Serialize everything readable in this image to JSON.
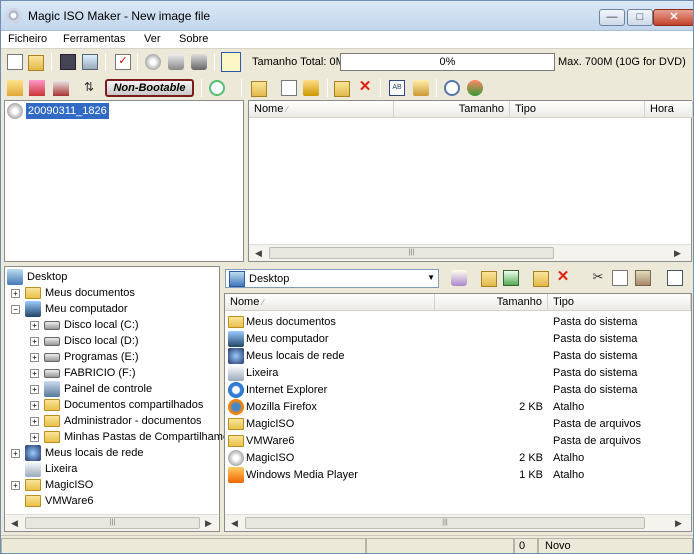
{
  "window": {
    "title": "Magic ISO Maker - New image file"
  },
  "menu": [
    "Ficheiro",
    "Ferramentas",
    "Ver",
    "Sobre"
  ],
  "toolbar": {
    "total_label": "Tamanho Total: 0M",
    "progress_text": "0%",
    "progress_value": 0,
    "max_label": "Max. 700M (10G for DVD)",
    "boot_button": "Non-Bootable"
  },
  "image_tree": {
    "root": "20090311_1826"
  },
  "image_list": {
    "columns": [
      "Nome",
      "Tamanho",
      "Tipo",
      "Hora"
    ]
  },
  "local_tree": {
    "items": [
      {
        "label": "Desktop",
        "level": 0,
        "icon": "desktop-icon"
      },
      {
        "label": "Meus documentos",
        "level": 1,
        "icon": "folder-icon"
      },
      {
        "label": "Meu computador",
        "level": 1,
        "icon": "computer-icon"
      },
      {
        "label": "Disco local (C:)",
        "level": 2,
        "icon": "drive-icon"
      },
      {
        "label": "Disco local (D:)",
        "level": 2,
        "icon": "drive-icon"
      },
      {
        "label": "Programas (E:)",
        "level": 2,
        "icon": "drive-icon"
      },
      {
        "label": "FABRICIO (F:)",
        "level": 2,
        "icon": "drive-icon"
      },
      {
        "label": "Painel de controle",
        "level": 2,
        "icon": "control-panel-icon"
      },
      {
        "label": "Documentos compartilhados",
        "level": 2,
        "icon": "folder-icon"
      },
      {
        "label": "Administrador - documentos",
        "level": 2,
        "icon": "folder-icon"
      },
      {
        "label": "Minhas Pastas de Compartilhamento",
        "level": 2,
        "icon": "share-folder-icon"
      },
      {
        "label": "Meus locais de rede",
        "level": 1,
        "icon": "network-icon"
      },
      {
        "label": "Lixeira",
        "level": 1,
        "icon": "recycle-bin-icon"
      },
      {
        "label": "MagicISO",
        "level": 1,
        "icon": "folder-icon"
      },
      {
        "label": "VMWare6",
        "level": 1,
        "icon": "folder-icon"
      }
    ]
  },
  "local_list": {
    "location": "Desktop",
    "columns": [
      "Nome",
      "Tamanho",
      "Tipo"
    ],
    "rows": [
      {
        "name": "Meus documentos",
        "size": "",
        "type": "Pasta do sistema",
        "icon": "folder-icon"
      },
      {
        "name": "Meu computador",
        "size": "",
        "type": "Pasta do sistema",
        "icon": "computer-icon"
      },
      {
        "name": "Meus locais de rede",
        "size": "",
        "type": "Pasta do sistema",
        "icon": "network-icon"
      },
      {
        "name": "Lixeira",
        "size": "",
        "type": "Pasta do sistema",
        "icon": "recycle-bin-icon"
      },
      {
        "name": "Internet Explorer",
        "size": "",
        "type": "Pasta do sistema",
        "icon": "ie-icon"
      },
      {
        "name": "Mozilla Firefox",
        "size": "2 KB",
        "type": "Atalho",
        "icon": "firefox-icon"
      },
      {
        "name": "MagicISO",
        "size": "",
        "type": "Pasta de arquivos",
        "icon": "folder-icon"
      },
      {
        "name": "VMWare6",
        "size": "",
        "type": "Pasta de arquivos",
        "icon": "folder-icon"
      },
      {
        "name": "MagicISO",
        "size": "2 KB",
        "type": "Atalho",
        "icon": "disc-icon"
      },
      {
        "name": "Windows Media Player",
        "size": "1 KB",
        "type": "Atalho",
        "icon": "media-player-icon"
      }
    ]
  },
  "status": {
    "count": "0",
    "state": "Novo"
  }
}
